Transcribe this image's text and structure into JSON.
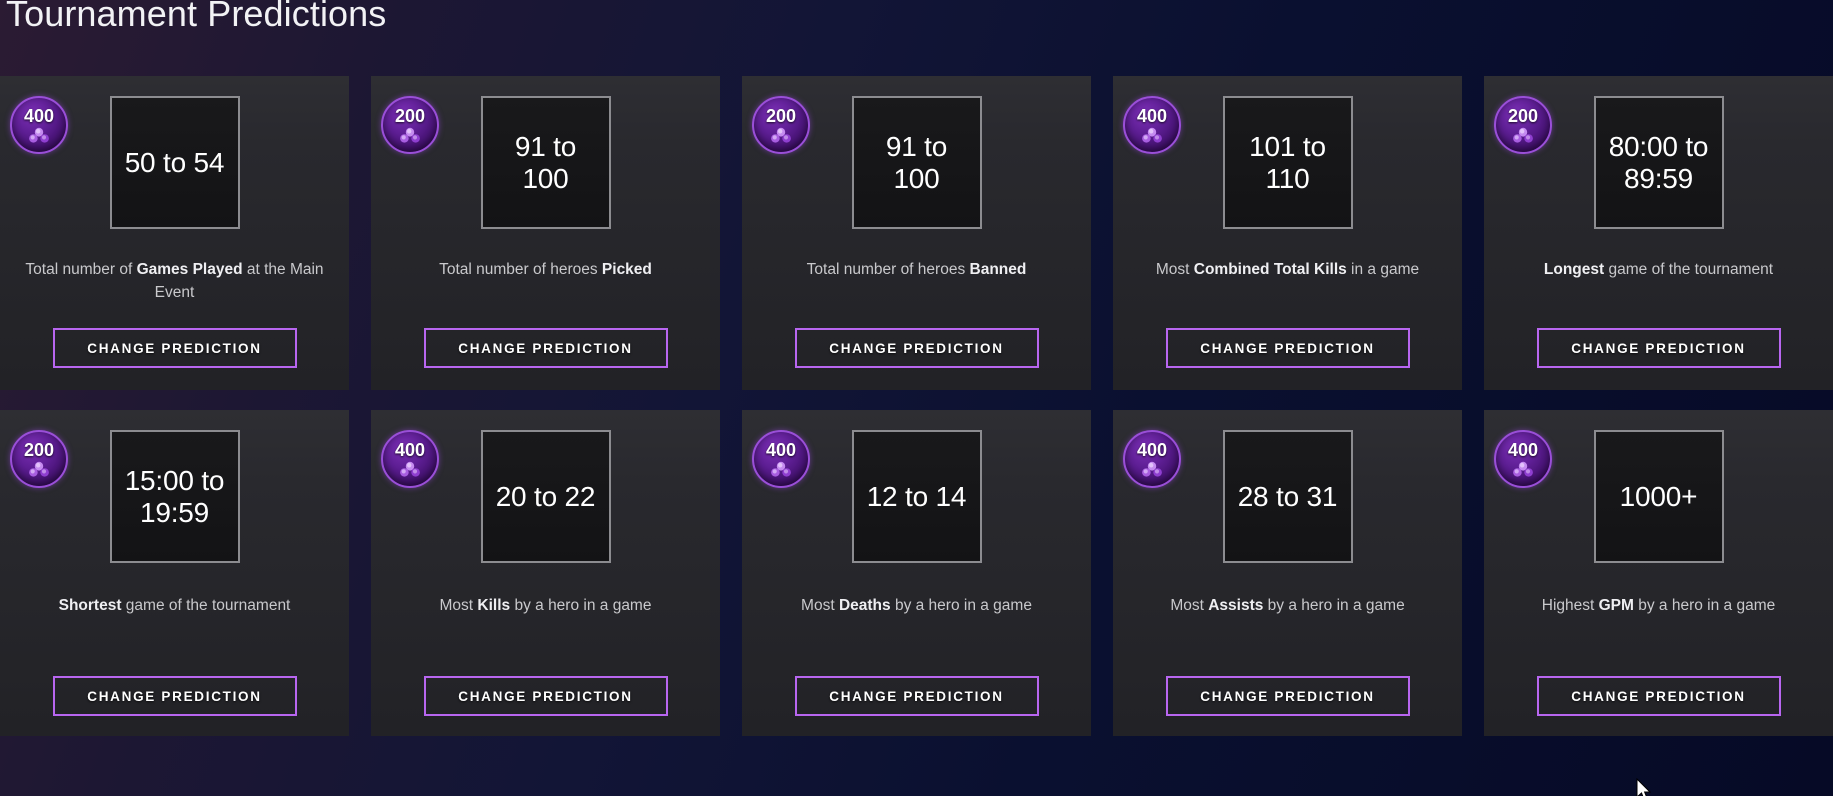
{
  "header": {
    "title": "Tournament Predictions"
  },
  "icons": {
    "gem": "gem-cluster-icon",
    "cursor": "mouse-cursor-icon"
  },
  "colors": {
    "accent_purple": "#b866f0",
    "badge_purple": "#5d1e93",
    "badge_border": "#9a4fd8",
    "card_bg": "#2a2a2e",
    "page_bg": "#0a1030",
    "pred_box_border": "#8c8c90",
    "pred_box_bg": "#19191b",
    "text_primary": "#ffffff",
    "text_secondary": "#c9c9cc"
  },
  "button_label": "CHANGE PREDICTION",
  "cards": [
    {
      "points": "400",
      "value": "50 to 54",
      "desc_prefix": "Total number of ",
      "desc_bold": "Games Played",
      "desc_suffix": " at the Main Event",
      "button": "CHANGE PREDICTION"
    },
    {
      "points": "200",
      "value": "91 to 100",
      "desc_prefix": "Total number of heroes ",
      "desc_bold": "Picked",
      "desc_suffix": "",
      "button": "CHANGE PREDICTION"
    },
    {
      "points": "200",
      "value": "91 to 100",
      "desc_prefix": "Total number of heroes ",
      "desc_bold": "Banned",
      "desc_suffix": "",
      "button": "CHANGE PREDICTION"
    },
    {
      "points": "400",
      "value": "101 to 110",
      "desc_prefix": "Most ",
      "desc_bold": "Combined Total Kills",
      "desc_suffix": " in a game",
      "button": "CHANGE PREDICTION"
    },
    {
      "points": "200",
      "value": "80:00 to 89:59",
      "desc_prefix": "",
      "desc_bold": "Longest",
      "desc_suffix": " game of the tournament",
      "button": "CHANGE PREDICTION"
    },
    {
      "points": "200",
      "value": "15:00 to 19:59",
      "desc_prefix": "",
      "desc_bold": "Shortest",
      "desc_suffix": " game of the tournament",
      "button": "CHANGE PREDICTION"
    },
    {
      "points": "400",
      "value": "20 to 22",
      "desc_prefix": "Most ",
      "desc_bold": "Kills",
      "desc_suffix": " by a hero in a game",
      "button": "CHANGE PREDICTION"
    },
    {
      "points": "400",
      "value": "12 to 14",
      "desc_prefix": "Most ",
      "desc_bold": "Deaths",
      "desc_suffix": " by a hero in a game",
      "button": "CHANGE PREDICTION"
    },
    {
      "points": "400",
      "value": "28 to 31",
      "desc_prefix": "Most ",
      "desc_bold": "Assists",
      "desc_suffix": " by a hero in a game",
      "button": "CHANGE PREDICTION"
    },
    {
      "points": "400",
      "value": "1000+",
      "desc_prefix": "Highest ",
      "desc_bold": "GPM",
      "desc_suffix": " by a hero in a game",
      "button": "CHANGE PREDICTION"
    }
  ]
}
